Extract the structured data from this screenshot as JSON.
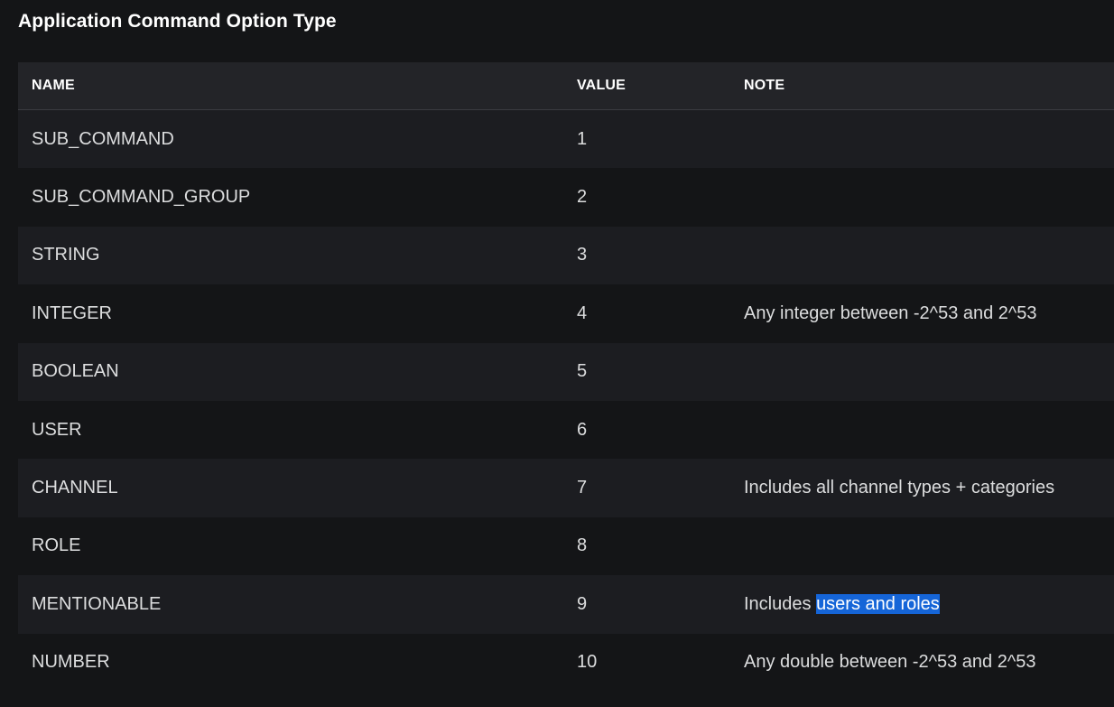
{
  "heading": "Application Command Option Type",
  "columns": {
    "name": "NAME",
    "value": "VALUE",
    "note": "NOTE"
  },
  "rows": [
    {
      "name": "SUB_COMMAND",
      "value": "1",
      "note": "",
      "note_selected": ""
    },
    {
      "name": "SUB_COMMAND_GROUP",
      "value": "2",
      "note": "",
      "note_selected": ""
    },
    {
      "name": "STRING",
      "value": "3",
      "note": "",
      "note_selected": ""
    },
    {
      "name": "INTEGER",
      "value": "4",
      "note": "Any integer between -2^53 and 2^53",
      "note_selected": ""
    },
    {
      "name": "BOOLEAN",
      "value": "5",
      "note": "",
      "note_selected": ""
    },
    {
      "name": "USER",
      "value": "6",
      "note": "",
      "note_selected": ""
    },
    {
      "name": "CHANNEL",
      "value": "7",
      "note": "Includes all channel types + categories",
      "note_selected": ""
    },
    {
      "name": "ROLE",
      "value": "8",
      "note": "",
      "note_selected": ""
    },
    {
      "name": "MENTIONABLE",
      "value": "9",
      "note": "Includes ",
      "note_selected": "users and roles"
    },
    {
      "name": "NUMBER",
      "value": "10",
      "note": "Any double between -2^53 and 2^53",
      "note_selected": ""
    }
  ],
  "colors": {
    "background": "#141517",
    "header_background": "#232428",
    "stripe": "#1c1d21",
    "text": "#dcddde",
    "selection": "#1565d8"
  }
}
